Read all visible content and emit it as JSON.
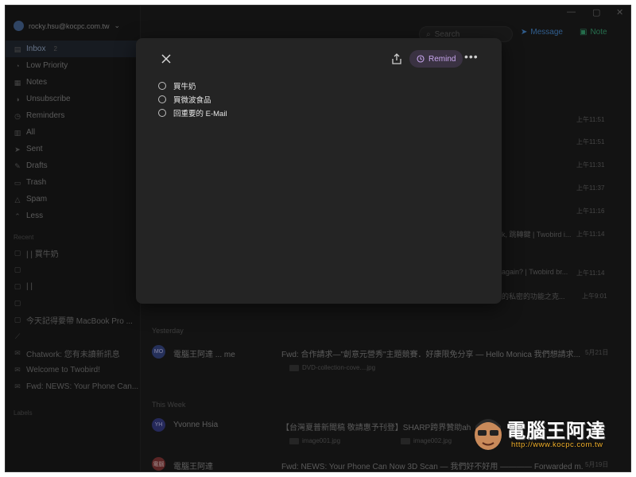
{
  "account": {
    "email": "rocky.hsu@kocpc.com.tw"
  },
  "sidebar": {
    "items": [
      {
        "label": "Inbox",
        "count": "2"
      },
      {
        "label": "Low Priority"
      },
      {
        "label": "Notes"
      },
      {
        "label": "Unsubscribe"
      },
      {
        "label": "Reminders"
      },
      {
        "label": "All"
      },
      {
        "label": "Sent"
      },
      {
        "label": "Drafts"
      },
      {
        "label": "Trash"
      },
      {
        "label": "Spam"
      },
      {
        "label": "Less"
      }
    ],
    "recent_label": "Recent",
    "recent": [
      {
        "label": "| | 買牛奶"
      },
      {
        "label": ""
      },
      {
        "label": "| |"
      },
      {
        "label": ""
      },
      {
        "label": "今天記得要帶 MacBook Pro ..."
      },
      {
        "label": ""
      },
      {
        "label": "Chatwork: 您有未讀新訊息"
      },
      {
        "label": "Welcome to Twobird!"
      },
      {
        "label": "Fwd: NEWS: Your Phone Can..."
      }
    ],
    "labels_label": "Labels"
  },
  "toolbar": {
    "search_placeholder": "Search",
    "message_label": "Message",
    "note_label": "Note"
  },
  "inbox_times": [
    "上午11:51",
    "上午11:51",
    "上午11:31",
    "上午11:37",
    "上午11:16",
    "上午11:14",
    "上午11:14",
    "上午9:01"
  ],
  "inbox_snippets": [
    "k, 跳轉鍵 | Twobird i...",
    "again? | Twobird br...",
    "的私密的功能之克..."
  ],
  "sections": {
    "yesterday": "Yesterday",
    "this_week": "This Week"
  },
  "messages": [
    {
      "avatar": "MO",
      "sender": "電腦王阿達 ... me",
      "subject": "Fwd: 合作請求—\"創意元營秀\"主題競賽．好康限免分享 — Hello Monica 我們想請求...",
      "time": "5月21日",
      "attachment": "DVD-collection-cove....jpg"
    },
    {
      "avatar": "YH",
      "sender": "Yvonne Hsia",
      "subject": "【台灣夏普新聞稿 敬請惠予刊登】SHARP跨界贊助ahq e-Sports...",
      "attachments": [
        "image001.jpg",
        "image002.jpg"
      ]
    },
    {
      "avatar": "電腦",
      "sender": "電腦王阿達",
      "subject": "Fwd: NEWS: Your Phone Can Now 3D Scan — 我們好不好用 ———— Forwarded m...",
      "time": "5月19日"
    }
  ],
  "modal": {
    "remind_label": "Remind",
    "todos": [
      {
        "text": "買牛奶"
      },
      {
        "text": "買微波食品"
      },
      {
        "text": "回重要的 E-Mail"
      }
    ]
  },
  "watermark": {
    "brand": "電腦王阿達",
    "url": "http://www.kocpc.com.tw"
  },
  "colors": {
    "remind_accent": "#c8a6ee",
    "note_accent": "#3aa876",
    "message_accent": "#4a8fd9"
  }
}
